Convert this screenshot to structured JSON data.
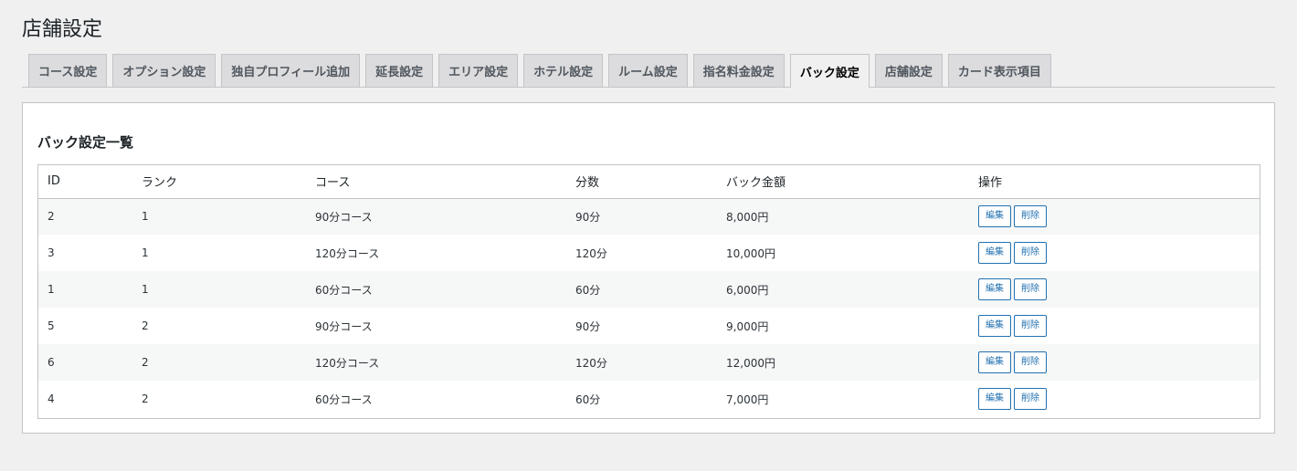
{
  "page": {
    "title": "店舗設定"
  },
  "tabs": [
    {
      "label": "コース設定",
      "active": false
    },
    {
      "label": "オプション設定",
      "active": false
    },
    {
      "label": "独自プロフィール追加",
      "active": false
    },
    {
      "label": "延長設定",
      "active": false
    },
    {
      "label": "エリア設定",
      "active": false
    },
    {
      "label": "ホテル設定",
      "active": false
    },
    {
      "label": "ルーム設定",
      "active": false
    },
    {
      "label": "指名料金設定",
      "active": false
    },
    {
      "label": "バック設定",
      "active": true
    },
    {
      "label": "店舗設定",
      "active": false
    },
    {
      "label": "カード表示項目",
      "active": false
    }
  ],
  "section": {
    "title": "バック設定一覧"
  },
  "table": {
    "headers": {
      "id": "ID",
      "rank": "ランク",
      "course": "コース",
      "minutes": "分数",
      "back_amount": "バック金額",
      "actions": "操作"
    },
    "rows": [
      {
        "id": "2",
        "rank": "1",
        "course": "90分コース",
        "minutes": "90分",
        "back_amount": "8,000円"
      },
      {
        "id": "3",
        "rank": "1",
        "course": "120分コース",
        "minutes": "120分",
        "back_amount": "10,000円"
      },
      {
        "id": "1",
        "rank": "1",
        "course": "60分コース",
        "minutes": "60分",
        "back_amount": "6,000円"
      },
      {
        "id": "5",
        "rank": "2",
        "course": "90分コース",
        "minutes": "90分",
        "back_amount": "9,000円"
      },
      {
        "id": "6",
        "rank": "2",
        "course": "120分コース",
        "minutes": "120分",
        "back_amount": "12,000円"
      },
      {
        "id": "4",
        "rank": "2",
        "course": "60分コース",
        "minutes": "60分",
        "back_amount": "7,000円"
      }
    ],
    "edit_label": "編集",
    "delete_label": "削除"
  },
  "colors": {
    "accent": "#2271b1",
    "background": "#f0f0f1",
    "border": "#c3c4c7",
    "tab_inactive": "#dcdcde"
  }
}
